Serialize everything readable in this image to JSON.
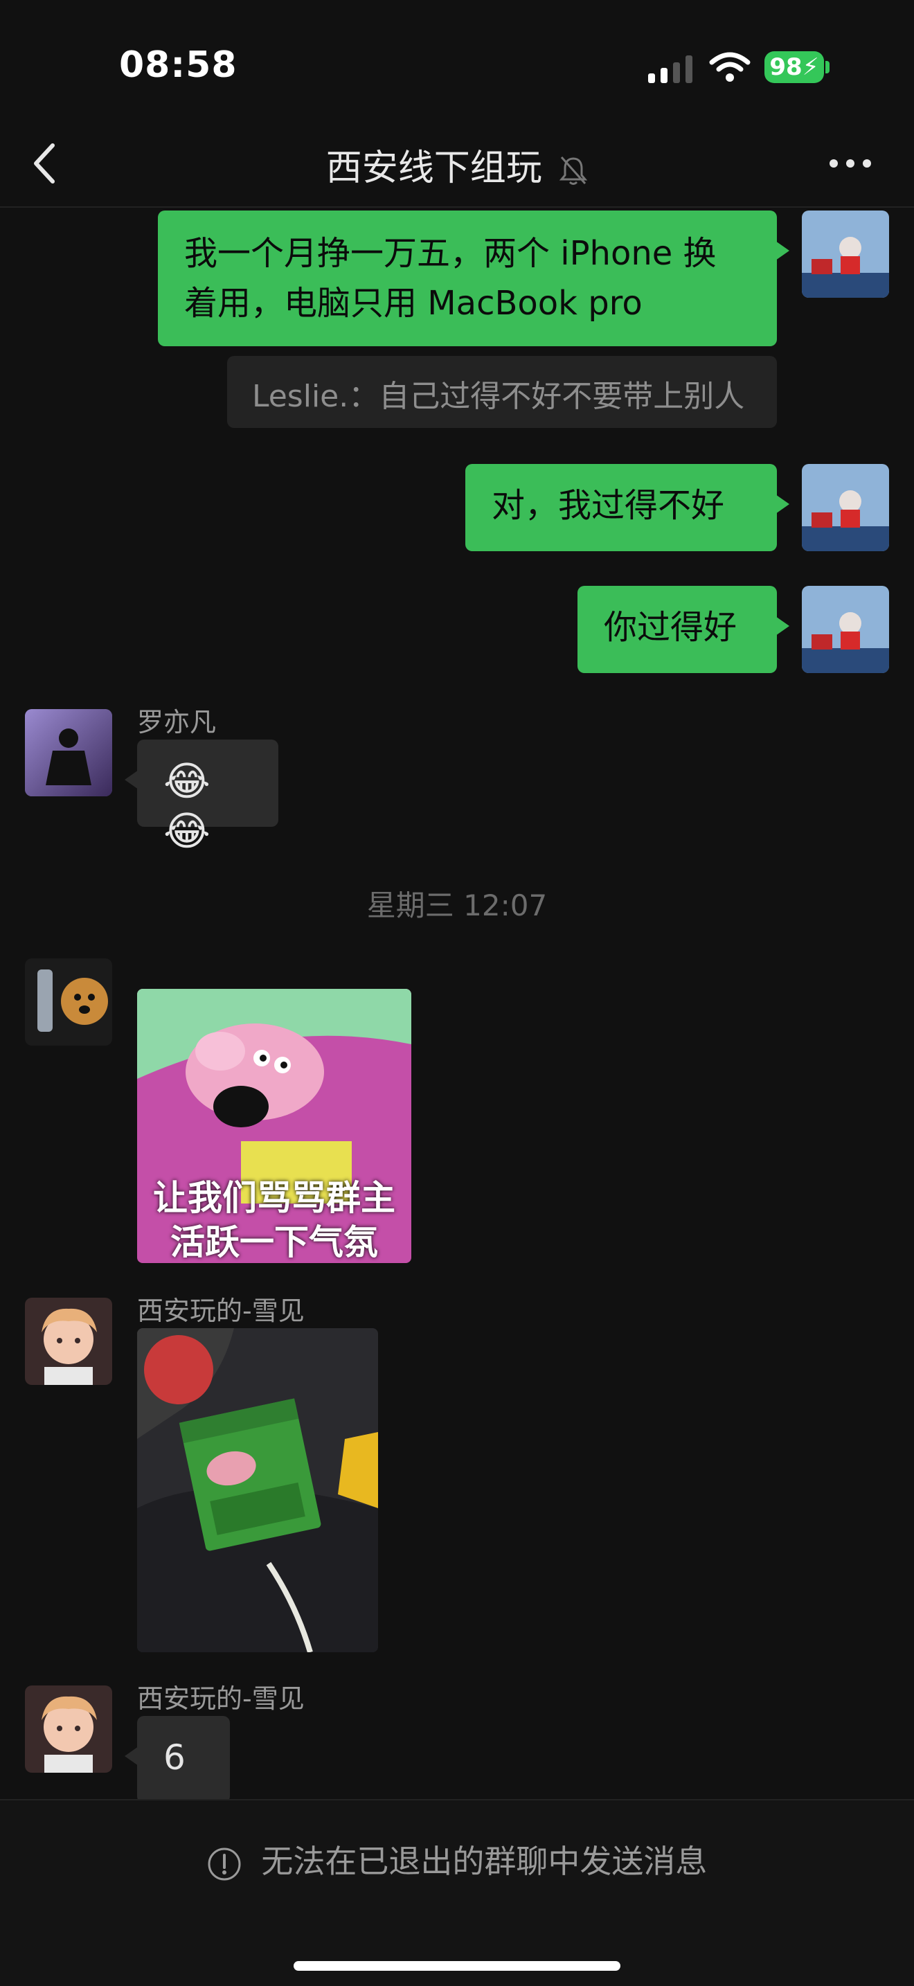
{
  "status_bar": {
    "time": "08:58",
    "battery": "98"
  },
  "header": {
    "title": "西安线下组玩"
  },
  "messages": {
    "m1": {
      "text_line1": "我一个月挣一万五，两个 iPhone 换",
      "text_line2": "着用，电脑只用 MacBook pro"
    },
    "quote": "Leslie.：自己过得不好不要带上别人",
    "m2": "对，我过得不好",
    "m3": "你过得好",
    "m4": {
      "sender": "罗亦凡",
      "text": "😂😂"
    },
    "timestamp": "星期三 12:07",
    "m5": {
      "sticker_caption_line1": "让我们骂骂群主",
      "sticker_caption_line2": "活跃一下气氛"
    },
    "m6": {
      "sender": "西安玩的-雪见"
    },
    "m7": {
      "sender": "西安玩的-雪见",
      "text": "6"
    }
  },
  "footer": {
    "notice": "无法在已退出的群聊中发送消息"
  },
  "colors": {
    "my_bubble": "#3bbd58",
    "other_bubble": "#2c2c2c",
    "background": "#111111"
  }
}
